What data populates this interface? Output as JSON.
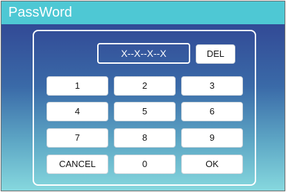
{
  "window": {
    "title": "PassWord"
  },
  "password": {
    "display": "X--X--X--X"
  },
  "buttons": {
    "del": "DEL",
    "keys": [
      "1",
      "2",
      "3",
      "4",
      "5",
      "6",
      "7",
      "8",
      "9"
    ],
    "cancel": "CANCEL",
    "zero": "0",
    "ok": "OK"
  },
  "colors": {
    "title_bar": "#4ec8d4",
    "background_top": "#2f3e8f",
    "background_bottom": "#86d8de",
    "button": "#ffffff",
    "text_light": "#ffffff",
    "text_dark": "#111111"
  }
}
